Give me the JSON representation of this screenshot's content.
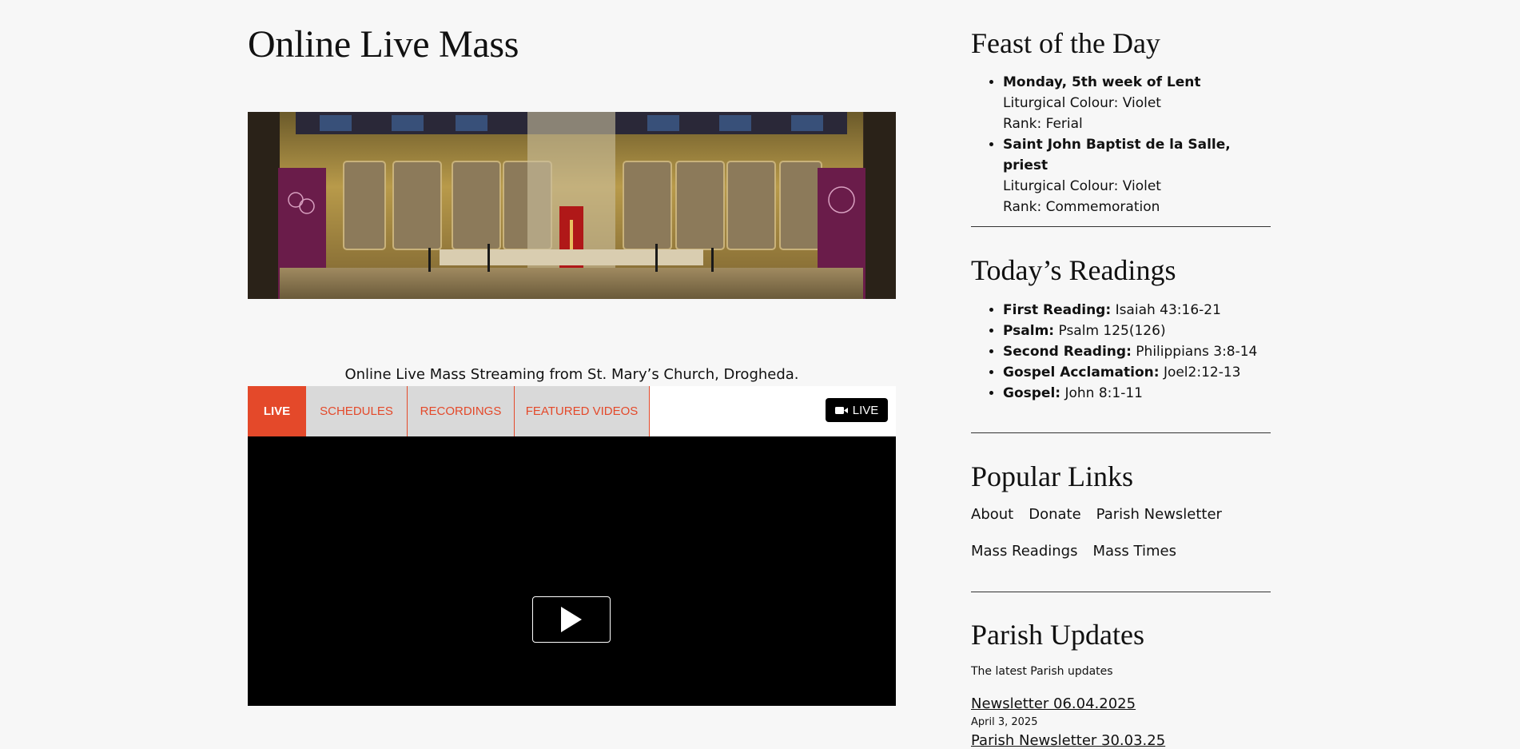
{
  "main": {
    "title": "Online Live Mass",
    "caption": "Online Live Mass Streaming from St. Mary’s Church, Drogheda."
  },
  "player": {
    "tabs": [
      "LIVE",
      "SCHEDULES",
      "RECORDINGS",
      "FEATURED VIDEOS"
    ],
    "live_badge": "LIVE",
    "accent": "#e4492a",
    "tab_bg": "#d9d9d9",
    "play_icon": "play-icon",
    "camera_icon": "video-camera-icon"
  },
  "feast": {
    "title": "Feast of the Day",
    "items": [
      {
        "name": "Monday, 5th week of Lent",
        "colour": "Liturgical Colour: Violet",
        "rank": "Rank: Ferial"
      },
      {
        "name": "Saint John Baptist de la Salle, priest",
        "colour": "Liturgical Colour: Violet",
        "rank": "Rank: Commemoration"
      }
    ]
  },
  "readings": {
    "title": "Today’s Readings",
    "items": [
      {
        "label": "First Reading:",
        "ref": "Isaiah 43:16-21"
      },
      {
        "label": "Psalm:",
        "ref": "Psalm 125(126)"
      },
      {
        "label": "Second Reading:",
        "ref": "Philippians 3:8-14"
      },
      {
        "label": "Gospel Acclamation:",
        "ref": "Joel2:12-13"
      },
      {
        "label": "Gospel:",
        "ref": "John 8:1-11"
      }
    ]
  },
  "popular_links": {
    "title": "Popular Links",
    "items": [
      "About",
      "Donate",
      "Parish Newsletter",
      "Mass Readings",
      "Mass Times"
    ]
  },
  "updates": {
    "title": "Parish Updates",
    "subtitle": "The latest Parish updates",
    "posts": [
      {
        "title": "Newsletter 06.04.2025",
        "date": "April 3, 2025"
      },
      {
        "title": "Parish Newsletter 30.03.25",
        "date": ""
      }
    ]
  }
}
